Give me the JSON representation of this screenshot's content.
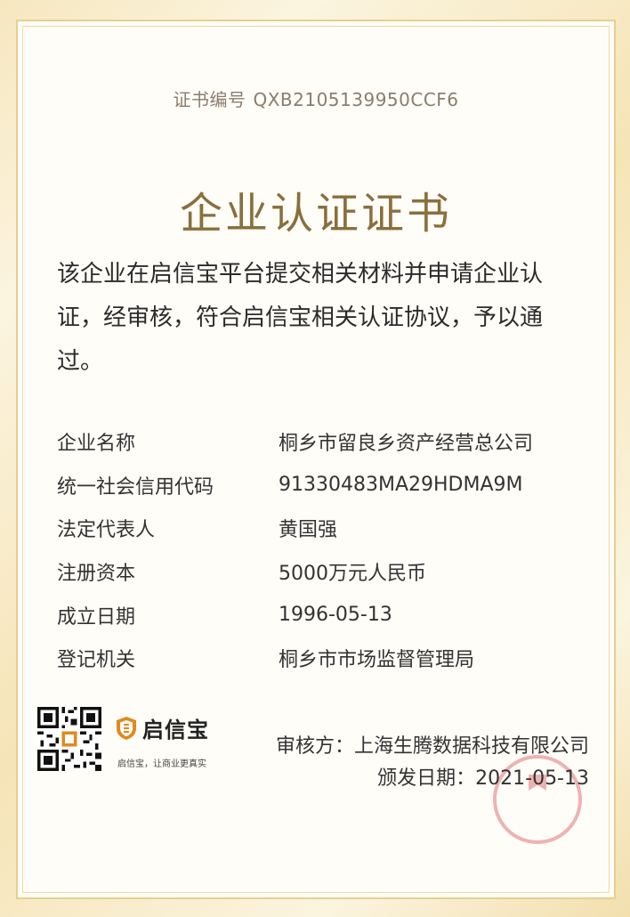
{
  "certificate": {
    "number_label": "证书编号",
    "number_value": "QXB2105139950CCF6",
    "title": "企业认证证书",
    "statement": "该企业在启信宝平台提交相关材料并申请企业认证，经审核，符合启信宝相关认证协议，予以通过。"
  },
  "info": {
    "rows": [
      {
        "label": "企业名称",
        "value": "桐乡市留良乡资产经营总公司"
      },
      {
        "label": "统一社会信用代码",
        "value": "91330483MA29HDMA9M"
      },
      {
        "label": "法定代表人",
        "value": "黄国强"
      },
      {
        "label": "注册资本",
        "value": "5000万元人民币"
      },
      {
        "label": "成立日期",
        "value": "1996-05-13"
      },
      {
        "label": "登记机关",
        "value": "桐乡市市场监督管理局"
      }
    ]
  },
  "footer": {
    "brand_name": "启信宝",
    "brand_slogan": "启信宝，让商业更真实",
    "issuer_label": "审核方：",
    "issuer_value": "上海生腾数据科技有限公司",
    "date_label": "颁发日期：",
    "date_value": "2021-05-13"
  },
  "colors": {
    "gold": "#8a6f3c",
    "border": "#e9cf8e",
    "seal": "#e89a9a",
    "brand_accent": "#e08a1e"
  },
  "icons": [
    "qr-code-icon",
    "qixinbao-logo-icon",
    "seal-stamp-icon"
  ]
}
